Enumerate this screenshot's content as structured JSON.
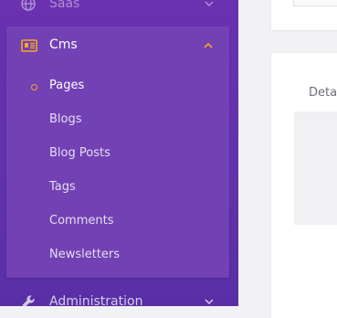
{
  "sidebar": {
    "top_item": {
      "label": "Saas",
      "icon": "globe-icon"
    },
    "cms": {
      "label": "Cms",
      "icon": "newspaper-icon",
      "expanded": true,
      "items": [
        {
          "label": "Pages",
          "active": true
        },
        {
          "label": "Blogs",
          "active": false
        },
        {
          "label": "Blog Posts",
          "active": false
        },
        {
          "label": "Tags",
          "active": false
        },
        {
          "label": "Comments",
          "active": false
        },
        {
          "label": "Newsletters",
          "active": false
        }
      ]
    },
    "admin_item": {
      "label": "Administration",
      "icon": "wrench-icon"
    }
  },
  "main": {
    "details_label": "Deta"
  },
  "colors": {
    "sidebar_bg": "#6132ad",
    "panel_bg": "#7241b4",
    "accent": "#f6a623",
    "text": "#ffffff"
  }
}
